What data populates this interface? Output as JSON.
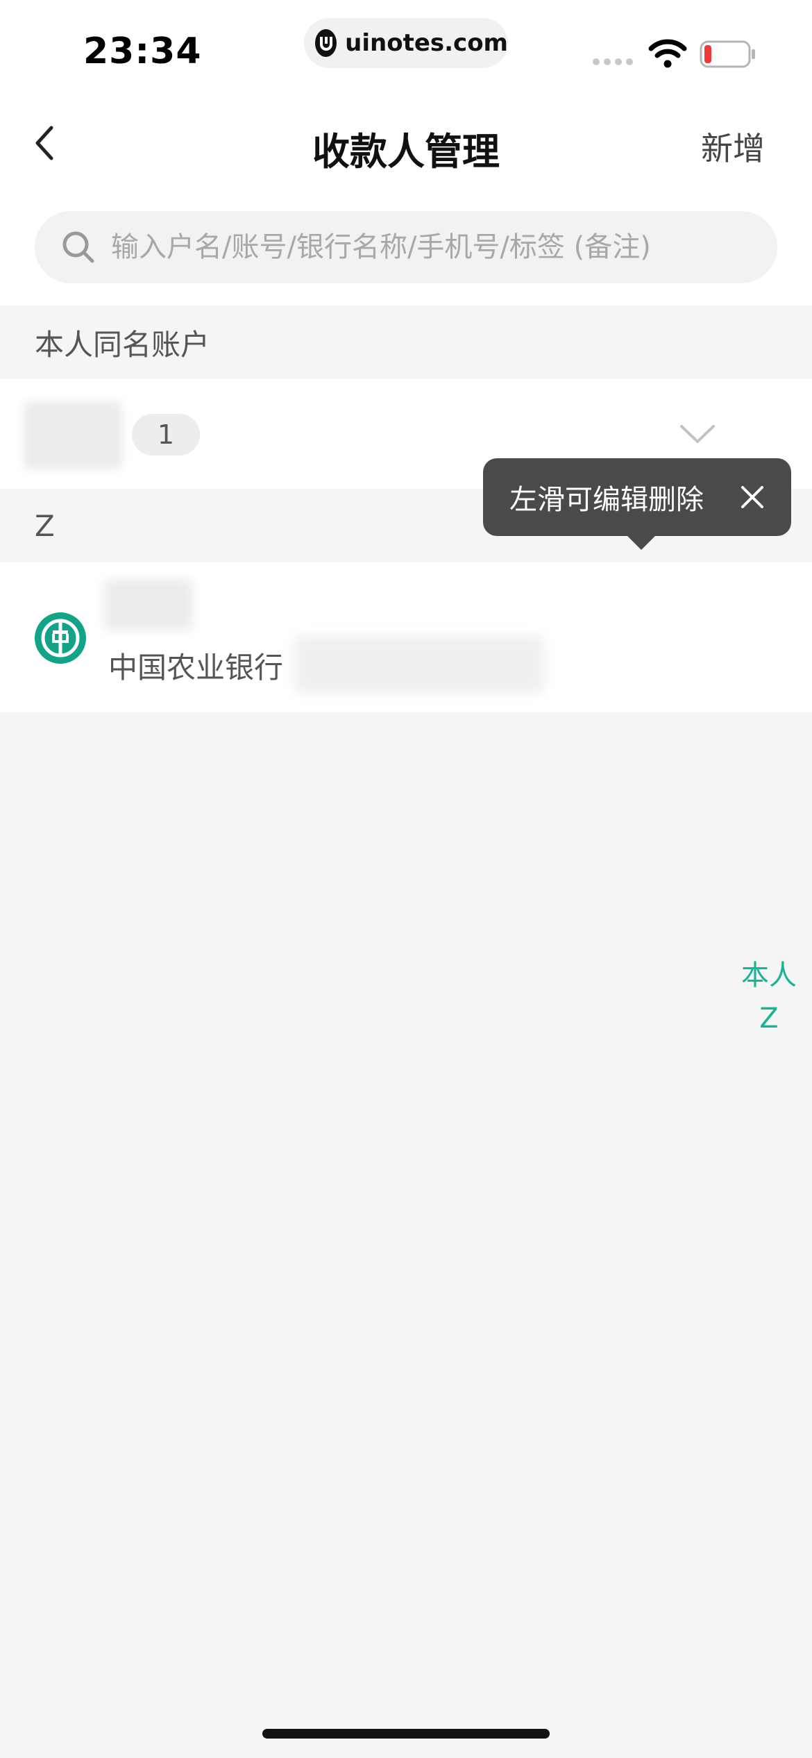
{
  "status_bar": {
    "time": "23:34",
    "url": "uinotes.com"
  },
  "nav": {
    "title": "收款人管理",
    "add_label": "新增"
  },
  "search": {
    "placeholder": "输入户名/账号/银行名称/手机号/标签 (备注)"
  },
  "sections": [
    {
      "header": "本人同名账户",
      "group_count": "1"
    },
    {
      "header": "Z",
      "payees": [
        {
          "bank": "中国农业银行"
        }
      ]
    }
  ],
  "tooltip": {
    "text": "左滑可编辑删除"
  },
  "index_bar": [
    "本人",
    "Z"
  ],
  "colors": {
    "accent": "#1ab394",
    "bank_logo": "#13a387",
    "tooltip_bg": "#4a4a4a"
  }
}
